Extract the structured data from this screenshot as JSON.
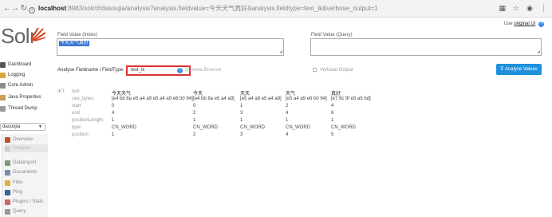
{
  "browser": {
    "url_host": "localhost",
    "url_rest": ":8983/solr/#/dasoujia/analysis?analysis.fieldvalue=今天天气真好&analysis.fieldtype=text_ik&verbose_output=1",
    "back_icon": "arrow-left-icon",
    "forward_icon": "arrow-right-icon",
    "reload_icon": "reload-icon"
  },
  "logo": {
    "text": "Solr"
  },
  "sidebar": {
    "items": [
      {
        "label": "Dashboard",
        "icon": "dashboard-icon",
        "color": "#555555"
      },
      {
        "label": "Logging",
        "icon": "logging-icon",
        "color": "#d8a83a"
      },
      {
        "label": "Core Admin",
        "icon": "core-admin-icon",
        "color": "#8a8a8a"
      },
      {
        "label": "Java Properties",
        "icon": "java-icon",
        "color": "#c8a050"
      },
      {
        "label": "Thread Dump",
        "icon": "thread-dump-icon",
        "color": "#9a9a9a"
      }
    ],
    "core_selector": "dasoujia",
    "core_items": [
      {
        "label": "Overview",
        "icon": "home-icon",
        "color": "#c05030"
      },
      {
        "label": "Analysis",
        "icon": "analysis-icon",
        "color": "#cfcfcf"
      },
      {
        "label": "Dataimport",
        "icon": "dataimport-icon",
        "color": "#7a9a7a"
      },
      {
        "label": "Documents",
        "icon": "documents-icon",
        "color": "#7a8aaa"
      },
      {
        "label": "Files",
        "icon": "files-icon",
        "color": "#e0b040"
      },
      {
        "label": "Ping",
        "icon": "ping-icon",
        "color": "#336699"
      },
      {
        "label": "Plugins / Stats",
        "icon": "plugins-icon",
        "color": "#cc6666"
      },
      {
        "label": "Query",
        "icon": "query-icon",
        "color": "#999999"
      }
    ]
  },
  "main": {
    "use_original_prefix": "Use",
    "use_original_link": "original UI",
    "field_value_index": {
      "label": "Field Value (Index)",
      "value": "今天天气真好"
    },
    "field_value_query": {
      "label": "Field Value (Query)",
      "value": ""
    },
    "fieldtype_label": "Analyse Fieldname / FieldType:",
    "fieldtype_value": "text_ik",
    "schema_browser": "Schema Browser",
    "verbose_output": "Verbose Output",
    "analyse_button": "Analyse Values"
  },
  "analysis": {
    "tokenizer": "IKT",
    "row_labels": [
      "text",
      "raw_bytes",
      "start",
      "end",
      "positionLength",
      "type",
      "position"
    ],
    "tokens": [
      {
        "text": "今天天气",
        "raw_bytes": "[e4 bb 8a e5 a4 a9 e5 a4 a9 e6 b0 94]",
        "start": "0",
        "end": "4",
        "positionLength": "1",
        "type": "CN_WORD",
        "position": "1"
      },
      {
        "text": "今天",
        "raw_bytes": "[e4 bb 8a e5 a4 a9]",
        "start": "0",
        "end": "2",
        "positionLength": "1",
        "type": "CN_WORD",
        "position": "2"
      },
      {
        "text": "天天",
        "raw_bytes": "[e5 a4 a9 e5 a4 a9]",
        "start": "1",
        "end": "3",
        "positionLength": "1",
        "type": "CN_WORD",
        "position": "3"
      },
      {
        "text": "天气",
        "raw_bytes": "[e5 a4 a9 e6 b0 94]",
        "start": "2",
        "end": "4",
        "positionLength": "1",
        "type": "CN_WORD",
        "position": "4"
      },
      {
        "text": "真好",
        "raw_bytes": "[e7 9c 9f e5 a5 bd]",
        "start": "4",
        "end": "6",
        "positionLength": "1",
        "type": "CN_WORD",
        "position": "5"
      }
    ]
  }
}
